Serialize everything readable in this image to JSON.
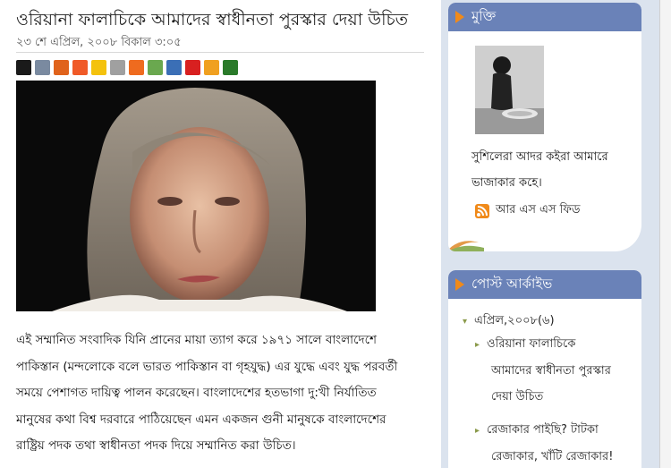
{
  "post": {
    "title": "ওরিয়ানা ফালাচিকে আমাদের স্বাধীনতা পুরস্কার দেয়া উচিত",
    "date": "২৩ শে এপ্রিল, ২০০৮ বিকাল ৩:০৫",
    "body_lines": [
      "এই সম্মানিত সংবাদিক যিনি প্রানের মায়া ত্যাগ করে ১৯৭১ সালে বাংলাদেশে",
      "পাকিস্তান (মন্দলোকে বলে ভারত পাকিস্তান বা গৃহযুদ্ধ) এর যুদ্ধে এবং যুদ্ধ পরবর্তী",
      "সময়ে পেশাগত দায়িত্ব পালন করেছেন। বাংলাদেশের হতভাগা দু:খী নির্যাতিত",
      "মানুষের কথা বিশ্ব দরবারে পাঠিয়েছেন এমন একজন গুনী মানুষকে বাংলাদেশের",
      "রাষ্ট্রিয় পদক তথা স্বাধীনতা পদক দিয়ে সম্মানিত করা উচিত।"
    ]
  },
  "share_icons": [
    {
      "name": "delicious-icon",
      "color": "#1a1a1a"
    },
    {
      "name": "digg-icon",
      "color": "#7a8aa0"
    },
    {
      "name": "facebook-icon",
      "color": "#e0631c"
    },
    {
      "name": "reddit-icon",
      "color": "#f05a28"
    },
    {
      "name": "favorites-icon",
      "color": "#f4c20d"
    },
    {
      "name": "alien-icon",
      "color": "#a0a0a0"
    },
    {
      "name": "stumble-icon",
      "color": "#ef6b1f"
    },
    {
      "name": "bubble-icon",
      "color": "#6aa84f"
    },
    {
      "name": "windows-icon",
      "color": "#3b6fb6"
    },
    {
      "name": "yahoo-icon",
      "color": "#d82020"
    },
    {
      "name": "grid-icon",
      "color": "#f0a020"
    },
    {
      "name": "bookmark-icon",
      "color": "#2a7a2a"
    }
  ],
  "sidebar": {
    "profile": {
      "title": "মুক্তি",
      "bio_line1": "সুশিলেরা আদর কইরা আমারে",
      "bio_line2": "ভাজাকার কহে।",
      "rss_label": "আর এস এস ফিড"
    },
    "archive": {
      "title": "পোস্ট আর্কাইভ",
      "month": "এপ্রিল,২০০৮(৬)",
      "items": [
        [
          "ওরিয়ানা ফালাচিকে",
          "আমাদের স্বাধীনতা পুরস্কার",
          "দেয়া উচিত"
        ],
        [
          "রেজাকার পাইছি? টাটকা",
          "রেজাকার, খাঁটি রেজাকার!"
        ]
      ]
    }
  },
  "colors": {
    "widget_header": "#6a82b8",
    "accent": "#f08a1a",
    "sidebar_bg": "#dbe3ee"
  }
}
